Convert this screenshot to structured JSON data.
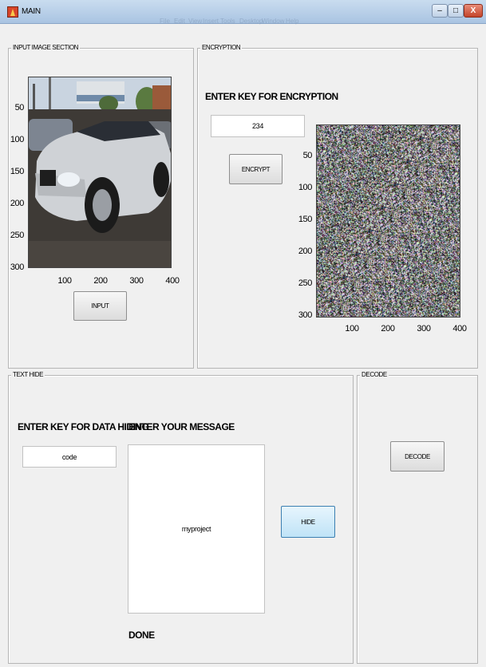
{
  "window": {
    "title": "MAIN",
    "menu_ghost": [
      "File",
      "Edit",
      "View",
      "Insert",
      "Tools",
      "Desktop",
      "Window",
      "Help"
    ],
    "buttons": {
      "minimize": "–",
      "maximize": "□",
      "close": "X"
    }
  },
  "input_section": {
    "title": "INPUT IMAGE SECTION",
    "axes": {
      "y_ticks": [
        "50",
        "100",
        "150",
        "200",
        "250",
        "300"
      ],
      "x_ticks": [
        "100",
        "200",
        "300",
        "400"
      ]
    },
    "input_button": "INPUT"
  },
  "encryption": {
    "title": "ENCRYPTION",
    "key_label": "ENTER KEY FOR ENCRYPTION",
    "key_value": "234",
    "encrypt_button": "ENCRYPT",
    "axes": {
      "y_ticks": [
        "50",
        "100",
        "150",
        "200",
        "250",
        "300"
      ],
      "x_ticks": [
        "100",
        "200",
        "300",
        "400"
      ]
    }
  },
  "text_hide": {
    "title": "TEXT HIDE",
    "key_label": "ENTER KEY FOR DATA HIDING",
    "key_value": "code",
    "message_label": "ENTER YOUR MESSAGE",
    "message_value": "myproject",
    "hide_button": "HIDE",
    "status": "DONE"
  },
  "decode": {
    "title": "DECODE",
    "decode_button": "DECODE"
  },
  "colors": {
    "window_bg": "#f0f0f0",
    "titlebar": "#b9d1ea",
    "active_button": "#bfe3f7",
    "close_button": "#c3442a"
  }
}
